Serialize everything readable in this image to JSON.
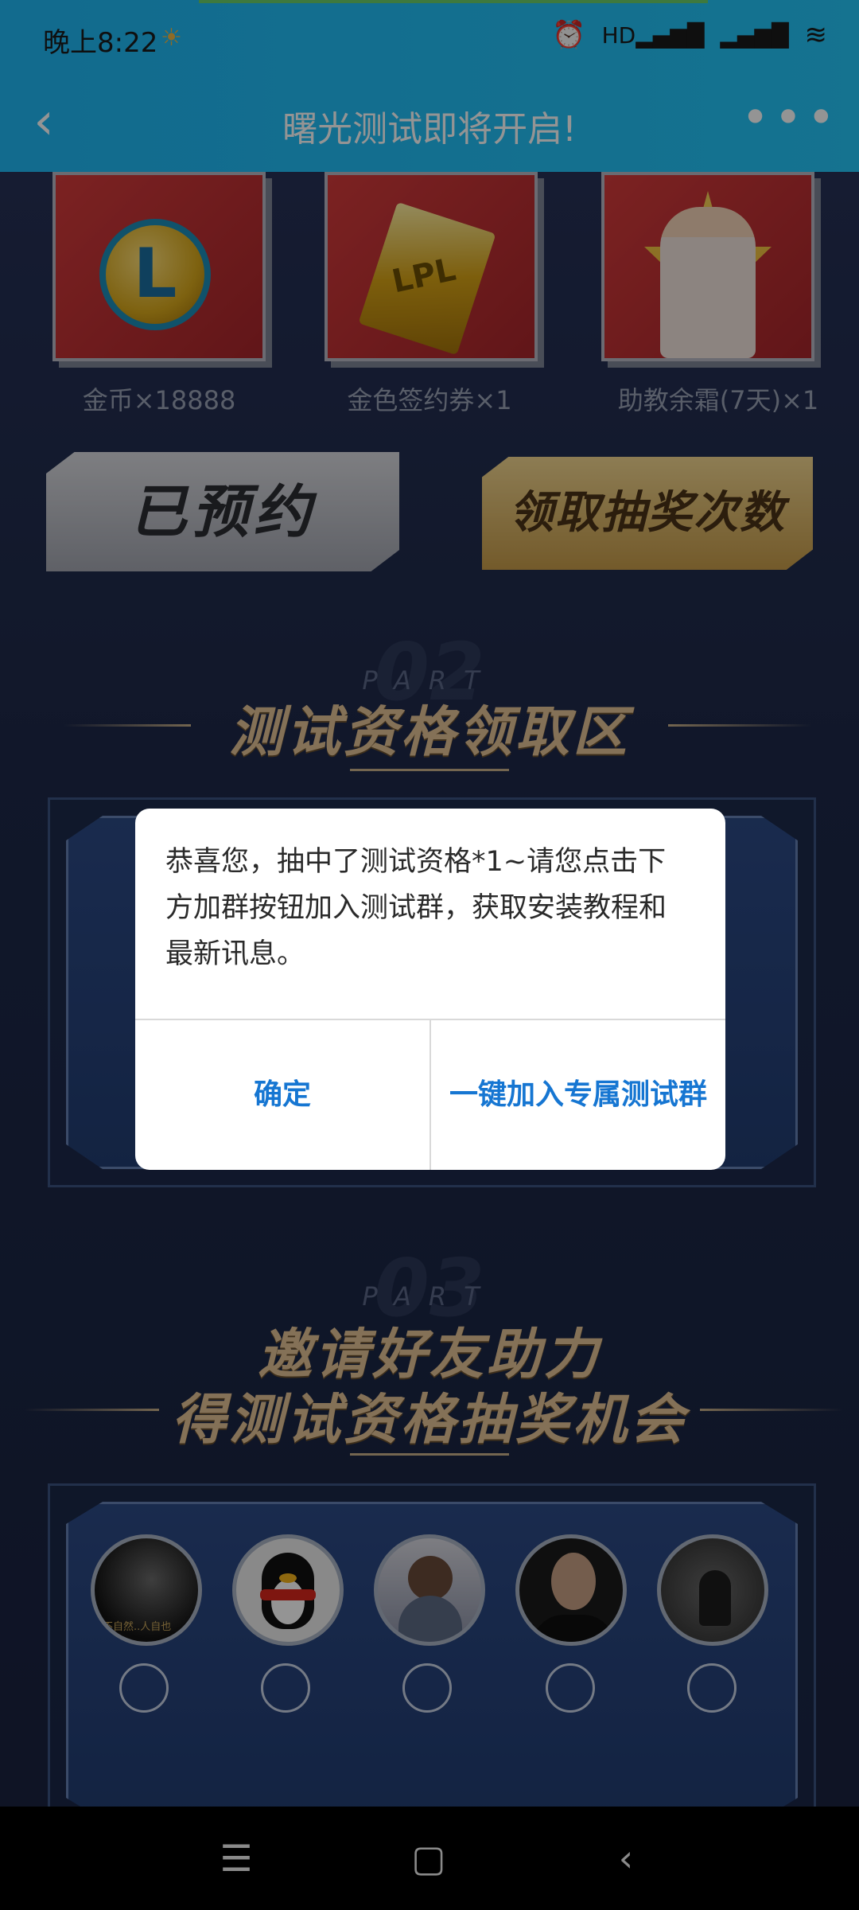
{
  "status_bar": {
    "time": "晚上8:22",
    "icons": [
      "sunrise-icon",
      "alarm-icon",
      "hd-signal-icon",
      "signal-icon",
      "wifi-icon"
    ]
  },
  "header": {
    "title": "曙光测试即将开启!",
    "back_icon": "chevron-left-icon",
    "more_icon": "more-horizontal-icon"
  },
  "rewards": [
    {
      "label": "金币×18888",
      "icon": "gold-coin-icon"
    },
    {
      "label": "金色签约券×1",
      "icon": "gold-ticket-icon",
      "ticket_text": "LPL"
    },
    {
      "label": "助教余霜(7天)×1",
      "icon": "assistant-character-image"
    }
  ],
  "buttons": {
    "reserved": "已预约",
    "claim_draws": "领取抽奖次数"
  },
  "section2": {
    "part_label": "PART",
    "part_number": "02",
    "title": "测试资格领取区"
  },
  "section3": {
    "part_label": "PART",
    "part_number": "03",
    "title_line1": "邀请好友助力",
    "title_line2": "得测试资格抽奖机会"
  },
  "friends": [
    {
      "avatar": "friend-avatar-1",
      "avatar_caption": "不自然..人自也"
    },
    {
      "avatar": "qq-penguin-avatar"
    },
    {
      "avatar": "friend-avatar-3"
    },
    {
      "avatar": "friend-avatar-4"
    },
    {
      "avatar": "friend-avatar-5"
    }
  ],
  "dialog": {
    "message": "恭喜您，抽中了测试资格*1~请您点击下方加群按钮加入测试群，获取安装教程和最新讯息。",
    "confirm": "确定",
    "join_group": "一键加入专属测试群"
  },
  "nav": {
    "menu_icon": "menu-icon",
    "home_icon": "home-square-icon",
    "back_icon": "back-triangle-icon"
  },
  "colors": {
    "header_bg": "#25c6f8",
    "dialog_button": "#1676d2",
    "title_gold": "#e3c396"
  }
}
